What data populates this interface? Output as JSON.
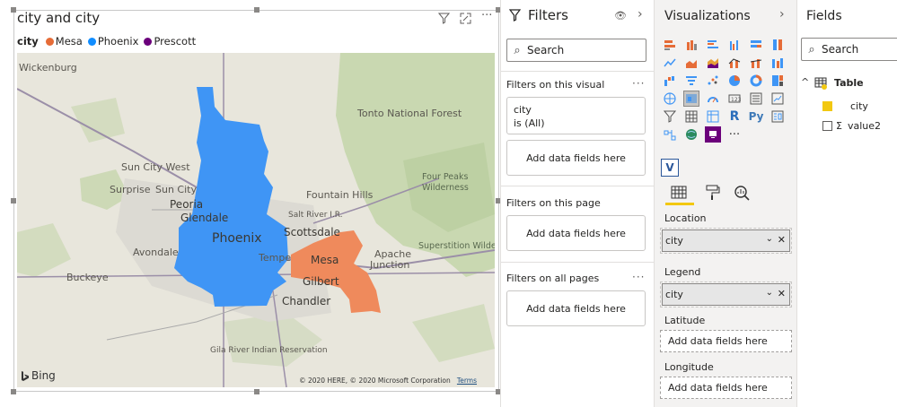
{
  "visual": {
    "title": "city and city",
    "legend_label": "city",
    "legend_items": [
      {
        "label": "Mesa",
        "color": "#E66C37"
      },
      {
        "label": "Phoenix",
        "color": "#118DFF"
      },
      {
        "label": "Prescott",
        "color": "#6B007B"
      }
    ],
    "map_labels": {
      "wickenburg": "Wickenburg",
      "tonto": "Tonto National Forest",
      "sun_city_west": "Sun City West",
      "surprise": "Surprise",
      "sun_city": "Sun City",
      "peoria": "Peoria",
      "glendale": "Glendale",
      "fountain_hills": "Fountain Hills",
      "salt_river": "Salt River I.R.",
      "four_peaks": "Four Peaks",
      "wilderness": "Wilderness",
      "phoenix": "Phoenix",
      "scottsdale": "Scottsdale",
      "superstition": "Superstition Wilder",
      "apache": "Apache",
      "junction": "Junction",
      "avondale": "Avondale",
      "tempe": "Tempe",
      "mesa": "Mesa",
      "buckeye": "Buckeye",
      "gilbert": "Gilbert",
      "chandler": "Chandler",
      "gila": "Gila River Indian Reservation"
    },
    "bing_label": "Bing",
    "copyright": "© 2020 HERE, © 2020 Microsoft Corporation",
    "terms": "Terms"
  },
  "filters": {
    "title": "Filters",
    "search_placeholder": "Search",
    "on_visual": "Filters on this visual",
    "city_card_title": "city",
    "city_card_value": "is (All)",
    "add_fields": "Add data fields here",
    "on_page": "Filters on this page",
    "on_all_pages": "Filters on all pages"
  },
  "visualizations": {
    "title": "Visualizations",
    "location_label": "Location",
    "location_value": "city",
    "legend_label": "Legend",
    "legend_value": "city",
    "latitude_label": "Latitude",
    "longitude_label": "Longitude",
    "add_fields": "Add data fields here"
  },
  "fields": {
    "title": "Fields",
    "search_placeholder": "Search",
    "table_name": "Table",
    "items": [
      {
        "label": "city",
        "checked": true
      },
      {
        "label": "value2",
        "checked": false
      }
    ]
  },
  "colors": {
    "phoenix": "#3f95f5",
    "mesa": "#ef8a5c",
    "accent_yellow": "#f2c811"
  }
}
